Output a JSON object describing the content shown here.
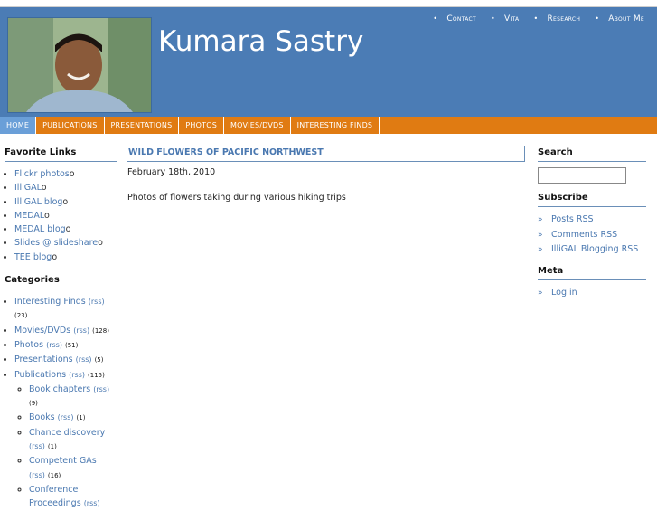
{
  "header": {
    "site_title": "Kumara Sastry",
    "top_nav": [
      "Contact",
      "Vita",
      "Research",
      "About Me"
    ]
  },
  "navbar": [
    "Home",
    "Publications",
    "Presentations",
    "Photos",
    "Movies/DVDs",
    "Interesting Finds"
  ],
  "left": {
    "favorites_heading": "Favorite Links",
    "favorites": [
      {
        "label": "Flickr photos",
        "suffix": "o"
      },
      {
        "label": "IlliGAL",
        "suffix": "o"
      },
      {
        "label": "IlliGAL blog",
        "suffix": "o"
      },
      {
        "label": "MEDAL",
        "suffix": "o"
      },
      {
        "label": "MEDAL blog",
        "suffix": "o"
      },
      {
        "label": "Slides @ slideshare",
        "suffix": "o"
      },
      {
        "label": "TEE blog",
        "suffix": "o"
      }
    ],
    "categories_heading": "Categories",
    "categories": [
      {
        "label": "Interesting Finds",
        "rss": "(rss)",
        "count": "(23)"
      },
      {
        "label": "Movies/DVDs",
        "rss": "(rss)",
        "count": "(128)"
      },
      {
        "label": "Photos",
        "rss": "(rss)",
        "count": "(51)"
      },
      {
        "label": "Presentations",
        "rss": "(rss)",
        "count": "(5)"
      },
      {
        "label": "Publications",
        "rss": "(rss)",
        "count": "(115)"
      }
    ],
    "subcategories": [
      {
        "label": "Book chapters",
        "rss": "(rss)",
        "count": "(9)"
      },
      {
        "label": "Books",
        "rss": "(rss)",
        "count": "(1)"
      },
      {
        "label": "Chance discovery",
        "rss": "(rss)",
        "count": "(1)"
      },
      {
        "label": "Competent GAs",
        "rss": "(rss)",
        "count": "(16)"
      },
      {
        "label": "Conference Proceedings",
        "rss": "(rss)",
        "count": ""
      }
    ]
  },
  "main": {
    "post_title": "Wild Flowers of Pacific Northwest",
    "post_date": "February 18th, 2010",
    "post_body": "Photos of flowers taking during various hiking trips"
  },
  "right": {
    "search_heading": "Search",
    "subscribe_heading": "Subscribe",
    "subscribe": [
      "Posts RSS",
      "Comments RSS",
      "IlliGAL Blogging RSS"
    ],
    "meta_heading": "Meta",
    "meta": [
      "Log in"
    ],
    "arrow": "»"
  },
  "colors": {
    "header_blue": "#4b7cb5",
    "nav_orange": "#e07b12",
    "link_blue": "#4a78b0"
  }
}
